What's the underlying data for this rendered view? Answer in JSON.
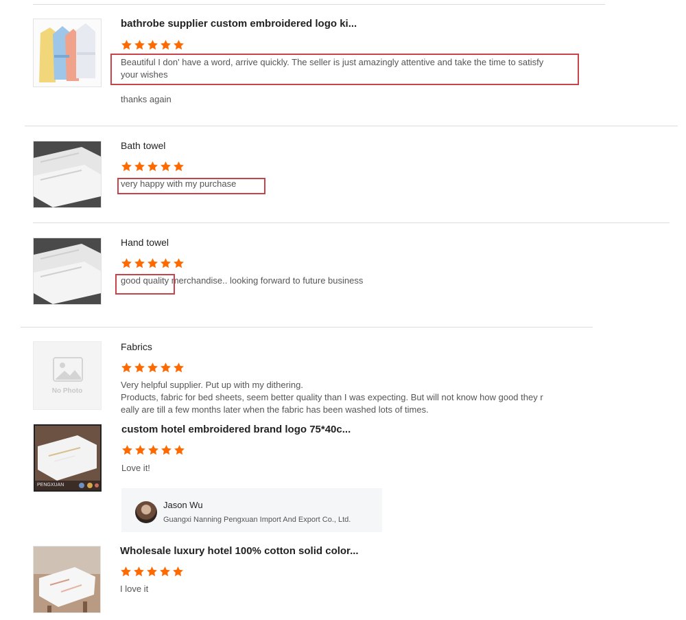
{
  "reviews": [
    {
      "product": "bathrobe supplier custom embroidered logo ki...",
      "rating": 5,
      "comment_lines": [
        "Beautiful I don' have a word, arrive quickly. The seller is just amazingly attentive and take the time to satisfy",
        "your wishes"
      ],
      "followup": "thanks again"
    },
    {
      "product": "Bath towel",
      "rating": 5,
      "comment": "very happy with my purchase"
    },
    {
      "product": "Hand towel",
      "rating": 5,
      "comment": "good quality merchandise.. looking forward to future business"
    },
    {
      "product": "Fabrics",
      "rating": 5,
      "image_placeholder": "No Photo",
      "comment_lines": [
        "Very helpful supplier. Put up with my dithering.",
        "Products, fabric for bed sheets, seem better quality than I was expecting. But will not know how good they r",
        "eally are till a few months later when the fabric has been washed lots of times."
      ]
    },
    {
      "product": "custom hotel embroidered brand logo 75*40c...",
      "rating": 5,
      "comment": "Love it!",
      "image_caption": "PENGXUAN",
      "reply": {
        "name": "Jason Wu",
        "company": "Guangxi Nanning Pengxuan Import And Export Co., Ltd."
      }
    },
    {
      "product": "Wholesale luxury hotel 100% cotton solid color...",
      "rating": 5,
      "comment": "I love it"
    }
  ],
  "colors": {
    "star": "#ff6a00",
    "highlight_box": "#c9424a",
    "divider": "#dcdcdc"
  }
}
